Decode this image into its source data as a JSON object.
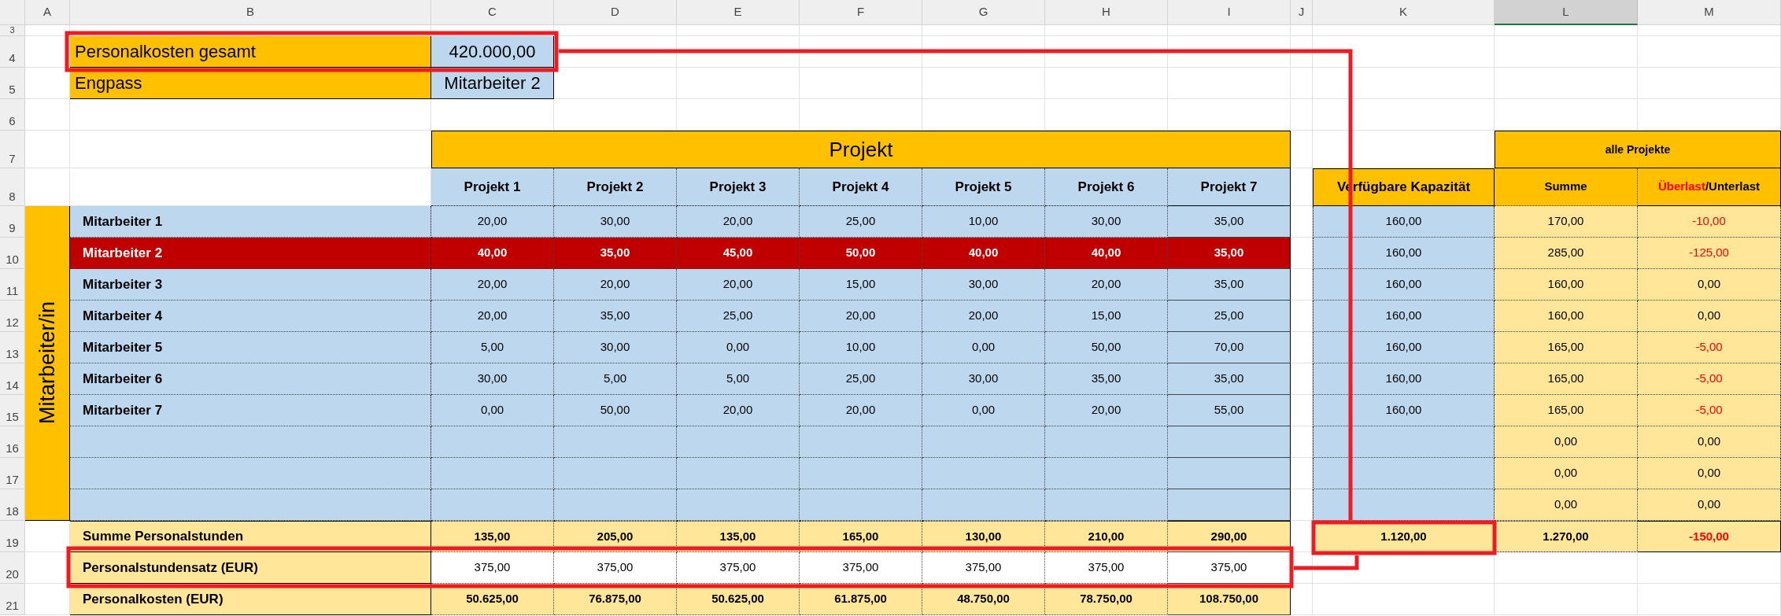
{
  "column_headers": [
    {
      "label": "A",
      "selected": false
    },
    {
      "label": "B",
      "selected": false
    },
    {
      "label": "C",
      "selected": false
    },
    {
      "label": "D",
      "selected": false
    },
    {
      "label": "E",
      "selected": false
    },
    {
      "label": "F",
      "selected": false
    },
    {
      "label": "G",
      "selected": false
    },
    {
      "label": "H",
      "selected": false
    },
    {
      "label": "I",
      "selected": false
    },
    {
      "label": "J",
      "selected": false
    },
    {
      "label": "K",
      "selected": false
    },
    {
      "label": "L",
      "selected": true
    },
    {
      "label": "M",
      "selected": false
    }
  ],
  "row_numbers": [
    "3",
    "4",
    "5",
    "6",
    "7",
    "8",
    "9",
    "10",
    "11",
    "12",
    "13",
    "14",
    "15",
    "16",
    "17",
    "18",
    "19",
    "20",
    "21"
  ],
  "summary": {
    "total_label": "Personalkosten gesamt",
    "total_value": "420.000,00",
    "bottleneck_label": "Engpass",
    "bottleneck_value": "Mitarbeiter 2"
  },
  "projects_header": "Projekt",
  "projects": [
    "Projekt 1",
    "Projekt 2",
    "Projekt 3",
    "Projekt 4",
    "Projekt 5",
    "Projekt 6",
    "Projekt 7"
  ],
  "capacity_header": "Verfügbare Kapazität",
  "all_projects_header": "alle Projekte",
  "sum_header": "Summe",
  "overload_label": "Überlast",
  "underload_label": "/Unterlast",
  "side_label": "Mitarbeiter/in",
  "employees": [
    {
      "name": "Mitarbeiter 1",
      "highlighted": false,
      "hours": [
        "20,00",
        "30,00",
        "20,00",
        "25,00",
        "10,00",
        "30,00",
        "35,00"
      ],
      "capacity": "160,00",
      "sum": "170,00",
      "balance": "-10,00",
      "balance_negative": true
    },
    {
      "name": "Mitarbeiter 2",
      "highlighted": true,
      "hours": [
        "40,00",
        "35,00",
        "45,00",
        "50,00",
        "40,00",
        "40,00",
        "35,00"
      ],
      "capacity": "160,00",
      "sum": "285,00",
      "balance": "-125,00",
      "balance_negative": true
    },
    {
      "name": "Mitarbeiter 3",
      "highlighted": false,
      "hours": [
        "20,00",
        "20,00",
        "20,00",
        "15,00",
        "30,00",
        "20,00",
        "35,00"
      ],
      "capacity": "160,00",
      "sum": "160,00",
      "balance": "0,00",
      "balance_negative": false
    },
    {
      "name": "Mitarbeiter 4",
      "highlighted": false,
      "hours": [
        "20,00",
        "35,00",
        "25,00",
        "20,00",
        "20,00",
        "15,00",
        "25,00"
      ],
      "capacity": "160,00",
      "sum": "160,00",
      "balance": "0,00",
      "balance_negative": false
    },
    {
      "name": "Mitarbeiter 5",
      "highlighted": false,
      "hours": [
        "5,00",
        "30,00",
        "0,00",
        "10,00",
        "0,00",
        "50,00",
        "70,00"
      ],
      "capacity": "160,00",
      "sum": "165,00",
      "balance": "-5,00",
      "balance_negative": true
    },
    {
      "name": "Mitarbeiter 6",
      "highlighted": false,
      "hours": [
        "30,00",
        "5,00",
        "5,00",
        "25,00",
        "30,00",
        "35,00",
        "35,00"
      ],
      "capacity": "160,00",
      "sum": "165,00",
      "balance": "-5,00",
      "balance_negative": true
    },
    {
      "name": "Mitarbeiter 7",
      "highlighted": false,
      "hours": [
        "0,00",
        "50,00",
        "20,00",
        "20,00",
        "0,00",
        "20,00",
        "55,00"
      ],
      "capacity": "160,00",
      "sum": "165,00",
      "balance": "-5,00",
      "balance_negative": true
    },
    {
      "highlighted": false,
      "sum": "0,00",
      "balance": "0,00",
      "balance_negative": false
    },
    {
      "highlighted": false,
      "sum": "0,00",
      "balance": "0,00",
      "balance_negative": false
    },
    {
      "highlighted": false,
      "sum": "0,00",
      "balance": "0,00",
      "balance_negative": false
    }
  ],
  "totals": {
    "label": "Summe Personalstunden",
    "values": [
      "135,00",
      "205,00",
      "135,00",
      "165,00",
      "130,00",
      "210,00",
      "290,00"
    ],
    "capacity": "1.120,00",
    "sum": "1.270,00",
    "balance": "-150,00",
    "balance_negative": true
  },
  "rate": {
    "label": "Personalstundensatz (EUR)",
    "values": [
      "375,00",
      "375,00",
      "375,00",
      "375,00",
      "375,00",
      "375,00",
      "375,00"
    ]
  },
  "costs": {
    "label": "Personalkosten (EUR)",
    "values": [
      "50.625,00",
      "76.875,00",
      "50.625,00",
      "61.875,00",
      "48.750,00",
      "78.750,00",
      "108.750,00"
    ]
  }
}
